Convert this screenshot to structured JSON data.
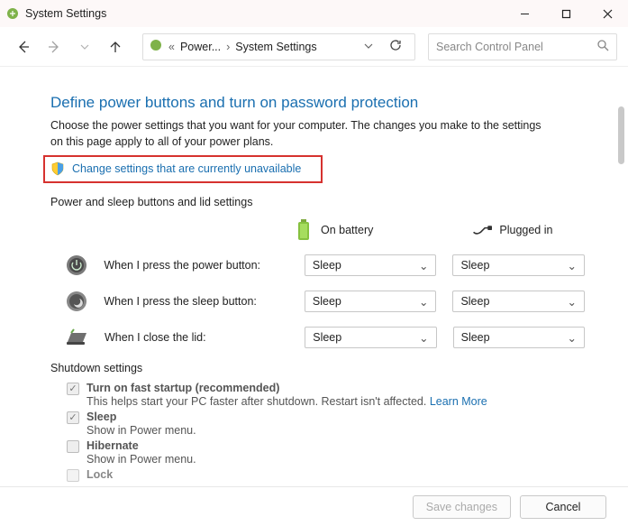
{
  "titlebar": {
    "title": "System Settings"
  },
  "toolbar": {
    "breadcrumb1": "Power...",
    "breadcrumb2": "System Settings",
    "search_placeholder": "Search Control Panel"
  },
  "page": {
    "heading": "Define power buttons and turn on password protection",
    "desc": "Choose the power settings that you want for your computer. The changes you make to the settings on this page apply to all of your power plans.",
    "change_link": "Change settings that are currently unavailable",
    "section_label": "Power and sleep buttons and lid settings",
    "col_battery": "On battery",
    "col_plugged": "Plugged in",
    "rows": [
      {
        "label": "When I press the power button:",
        "battery": "Sleep",
        "plugged": "Sleep"
      },
      {
        "label": "When I press the sleep button:",
        "battery": "Sleep",
        "plugged": "Sleep"
      },
      {
        "label": "When I close the lid:",
        "battery": "Sleep",
        "plugged": "Sleep"
      }
    ],
    "shutdown_header": "Shutdown settings",
    "shutdown_items": [
      {
        "title": "Turn on fast startup (recommended)",
        "sub": "This helps start your PC faster after shutdown. Restart isn't affected.",
        "learn": "Learn More",
        "checked": true
      },
      {
        "title": "Sleep",
        "sub": "Show in Power menu.",
        "checked": true
      },
      {
        "title": "Hibernate",
        "sub": "Show in Power menu.",
        "checked": false
      },
      {
        "title": "Lock",
        "sub": "",
        "checked": false
      }
    ]
  },
  "footer": {
    "save": "Save changes",
    "cancel": "Cancel"
  }
}
